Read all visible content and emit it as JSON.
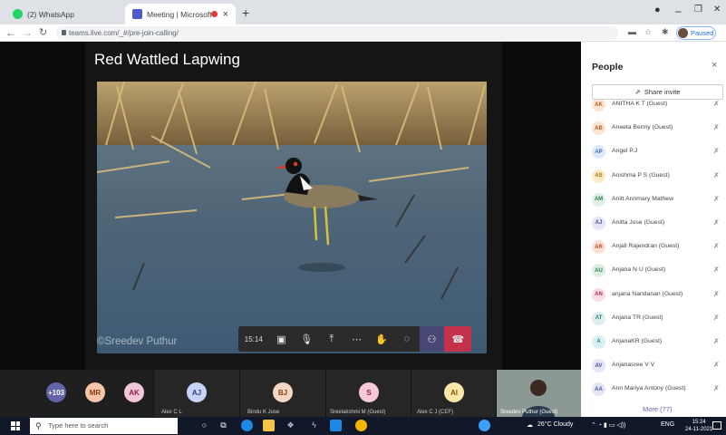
{
  "browser": {
    "tabs": [
      {
        "title": "(2) WhatsApp",
        "favicon_color": "#25d366"
      },
      {
        "title": "Meeting | Microsoft Teams",
        "favicon_color": "#5059c9"
      }
    ],
    "new_tab": "+",
    "close_glyph": "×",
    "url": "teams.live.com/_#/pre-join-calling/",
    "profile_status": "Paused",
    "window_controls": {
      "minimize": "–",
      "maximize": "❐",
      "close": "✕"
    }
  },
  "stage": {
    "slide_title": "Red Wattled Lapwing",
    "photo_credit": "©Sreedev Puthur",
    "call_timer": "15:14"
  },
  "strip": {
    "participants": [
      {
        "initials": "+103",
        "name": "",
        "color": "#6264a7",
        "fg": "#ffffff"
      },
      {
        "initials": "MR",
        "name": "",
        "color": "#f7c6a9",
        "fg": "#8a3a10"
      },
      {
        "initials": "AK",
        "name": "",
        "color": "#f4c6d9",
        "fg": "#8a1f4e"
      },
      {
        "initials": "AJ",
        "name": "Alex C L",
        "color": "#c7d4f5",
        "fg": "#2c3f8a"
      },
      {
        "initials": "BJ",
        "name": "Bindu K Jose",
        "color": "#f6d7c6",
        "fg": "#8a4010"
      },
      {
        "initials": "S",
        "name": "Sreelakshmi M (Guest)",
        "color": "#f7c8d8",
        "fg": "#8a1f4e"
      },
      {
        "initials": "AI",
        "name": "Alex C J (CEF)",
        "color": "#fbe7a7",
        "fg": "#7a5a00"
      }
    ],
    "presenter_name": "Sreedev Puthur (Guest)"
  },
  "people_panel": {
    "title": "People",
    "close": "×",
    "share_invite": "Share invite",
    "more": "More (77)",
    "people": [
      {
        "initials": "AK",
        "name": "ANITHA K T (Guest)",
        "color": "#fde3d1",
        "fg": "#b35a20"
      },
      {
        "initials": "AB",
        "name": "Aneeta Benny (Guest)",
        "color": "#fde3d1",
        "fg": "#b35a20"
      },
      {
        "initials": "AP",
        "name": "Angel P.J",
        "color": "#dbe9fb",
        "fg": "#3b6bb3"
      },
      {
        "initials": "AS",
        "name": "Anishma P S (Guest)",
        "color": "#fcebc5",
        "fg": "#a66f00"
      },
      {
        "initials": "AM",
        "name": "Anitt Annmary Mathew",
        "color": "#dff1e4",
        "fg": "#2e7d4a"
      },
      {
        "initials": "AJ",
        "name": "Anitta Jose (Guest)",
        "color": "#e4e6f6",
        "fg": "#4b4f9e"
      },
      {
        "initials": "AR",
        "name": "Anjali Rajendran (Guest)",
        "color": "#fde0d4",
        "fg": "#b34a20"
      },
      {
        "initials": "AU",
        "name": "Anjana N U (Guest)",
        "color": "#dcf0e2",
        "fg": "#2e7d4a"
      },
      {
        "initials": "AN",
        "name": "anjana Nandanan (Guest)",
        "color": "#fbdbe6",
        "fg": "#a3325a"
      },
      {
        "initials": "AT",
        "name": "Anjana TR (Guest)",
        "color": "#dcf0ef",
        "fg": "#2c7b77"
      },
      {
        "initials": "A",
        "name": "AnjanaKR (Guest)",
        "color": "#d8f0f2",
        "fg": "#2a7f86"
      },
      {
        "initials": "AV",
        "name": "Anjanasree V V",
        "color": "#e4e6f6",
        "fg": "#4b4f9e"
      },
      {
        "initials": "AA",
        "name": "Ann Mariya Antony (Guest)",
        "color": "#e4e6f6",
        "fg": "#4b4f9e"
      }
    ]
  },
  "taskbar": {
    "search_placeholder": "Type here to search",
    "weather": "26°C Cloudy",
    "lang": "ENG",
    "time": "15:24",
    "date": "24-11-2021"
  }
}
